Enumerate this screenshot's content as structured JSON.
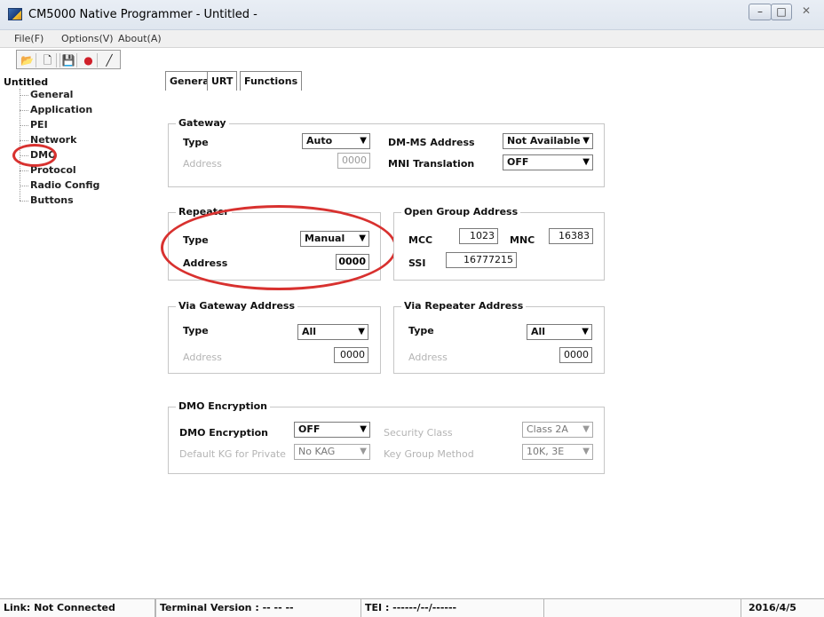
{
  "window": {
    "title": "CM5000 Native Programmer - Untitled -",
    "minimize_glyph": "–",
    "maximize_glyph": "□",
    "close_glyph": "✕"
  },
  "menu": [
    "File(F)",
    "Options(V)",
    "About(A)"
  ],
  "toolbar": [
    {
      "icon": "open-folder-icon",
      "glyph": "📂"
    },
    {
      "icon": "new-document-icon",
      "glyph": "🗋"
    },
    {
      "icon": "save-icon",
      "glyph": "💾"
    },
    {
      "icon": "record-icon",
      "glyph": "●"
    },
    {
      "icon": "line-icon",
      "glyph": "╱"
    }
  ],
  "tree": {
    "root": "Untitled",
    "items": [
      "General",
      "Application",
      "PEI",
      "Network",
      "DMO",
      "Protocol",
      "Radio Config",
      "Buttons"
    ]
  },
  "tabs": [
    "General",
    "URT",
    "Functions"
  ],
  "gateway": {
    "title": "Gateway",
    "type_label": "Type",
    "type_value": "Auto",
    "address_label": "Address",
    "address_value": "0000",
    "dmms_label": "DM-MS Address",
    "dmms_value": "Not Available",
    "mni_label": "MNI Translation",
    "mni_value": "OFF"
  },
  "repeater": {
    "title": "Repeater",
    "type_label": "Type",
    "type_value": "Manual",
    "address_label": "Address",
    "address_value": "0000"
  },
  "open_group": {
    "title": "Open Group Address",
    "mcc_label": "MCC",
    "mcc_value": "1023",
    "mnc_label": "MNC",
    "mnc_value": "16383",
    "ssi_label": "SSI",
    "ssi_value": "16777215"
  },
  "via_gateway": {
    "title": "Via Gateway Address",
    "type_label": "Type",
    "type_value": "All",
    "address_label": "Address",
    "address_value": "0000"
  },
  "via_repeater": {
    "title": "Via Repeater Address",
    "type_label": "Type",
    "type_value": "All",
    "address_label": "Address",
    "address_value": "0000"
  },
  "encryption": {
    "title": "DMO Encryption",
    "enc_label": "DMO Encryption",
    "enc_value": "OFF",
    "security_label": "Security Class",
    "security_value": "Class 2A",
    "default_kg_label": "Default KG for Private",
    "default_kg_value": "No KAG",
    "kgm_label": "Key Group Method",
    "kgm_value": "10K, 3E"
  },
  "status": {
    "link": "Link: Not Connected",
    "terminal": "Terminal Version : -- -- --",
    "tei": "TEI : ------/--/------",
    "date": "2016/4/5"
  },
  "colors": {
    "annotation": "#d8312f",
    "record": "#d0202a"
  }
}
